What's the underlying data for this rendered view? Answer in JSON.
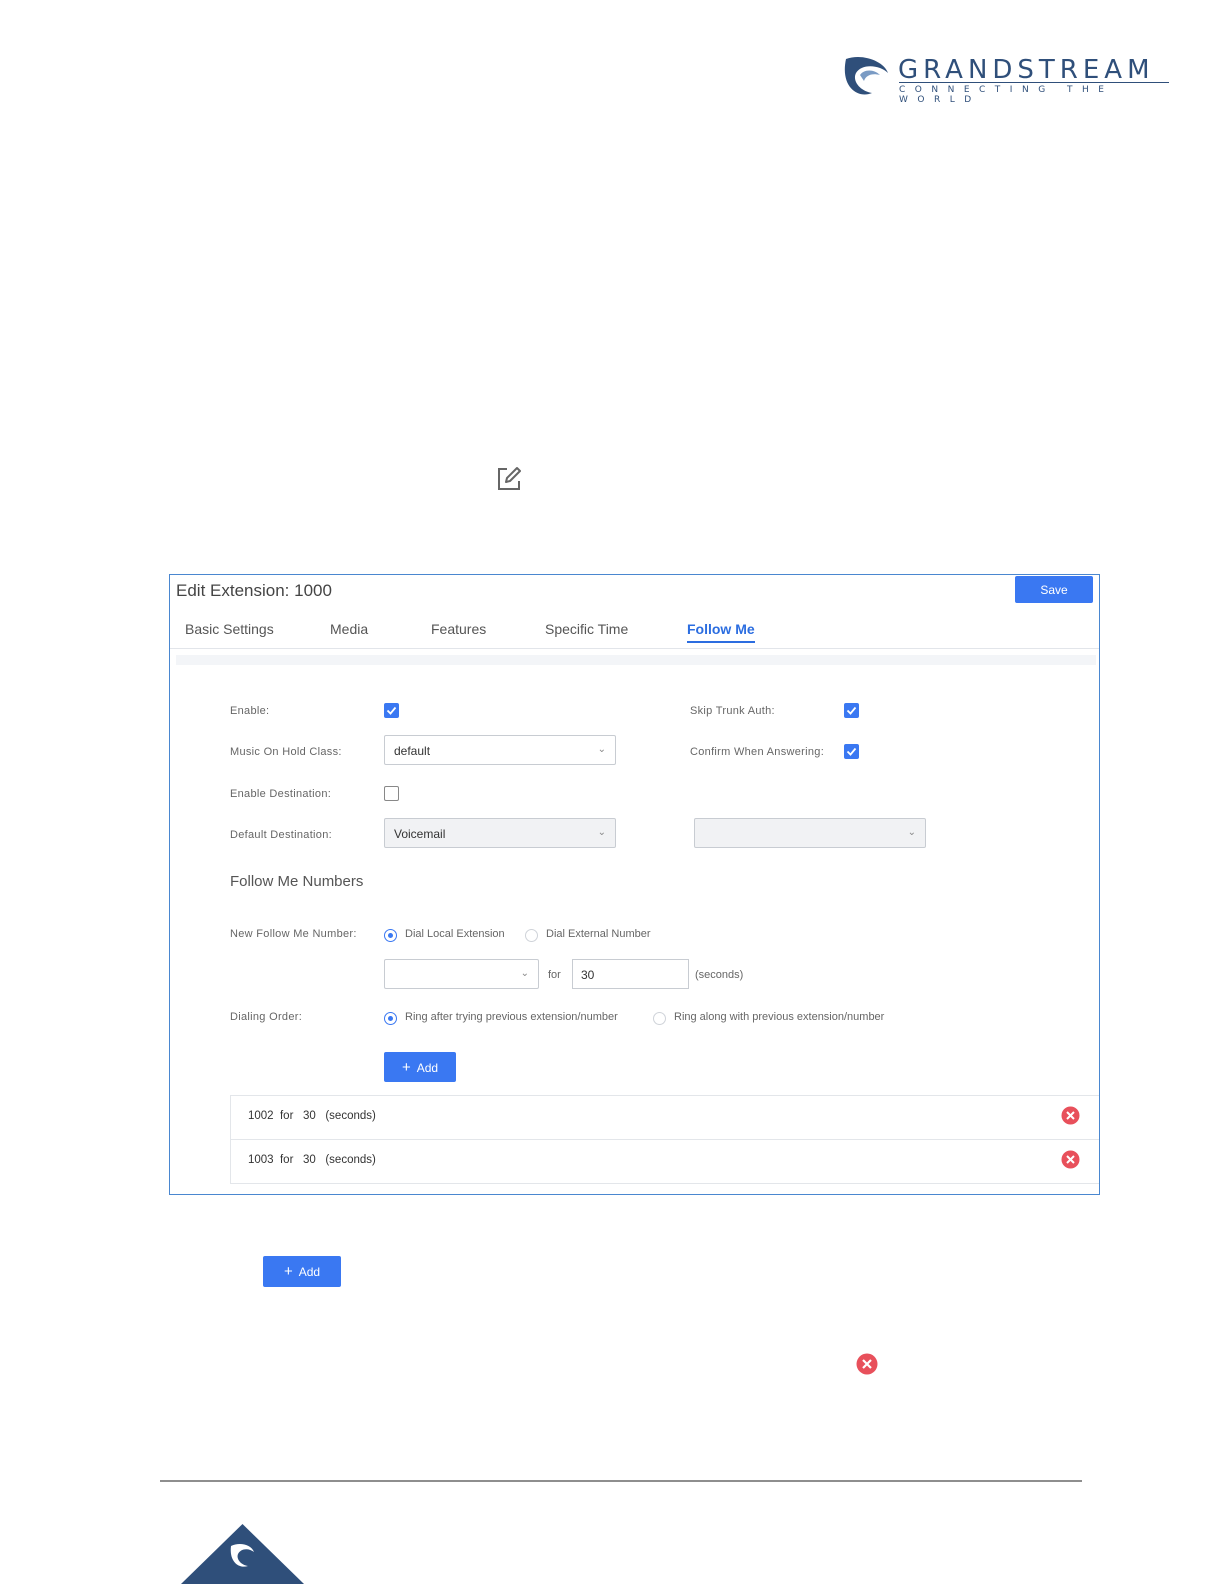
{
  "header": {
    "brand": "GRANDSTREAM",
    "tagline": "CONNECTING THE WORLD"
  },
  "dialog": {
    "title": "Edit Extension: 1000",
    "save_label": "Save",
    "tabs": [
      {
        "label": "Basic Settings"
      },
      {
        "label": "Media"
      },
      {
        "label": "Features"
      },
      {
        "label": "Specific Time"
      },
      {
        "label": "Follow Me",
        "active": true
      }
    ],
    "form": {
      "enable_label": "Enable:",
      "enable_checked": true,
      "skip_trunk_auth_label": "Skip Trunk Auth:",
      "skip_trunk_auth_checked": true,
      "music_on_hold_label": "Music On Hold Class:",
      "music_on_hold_value": "default",
      "confirm_answering_label": "Confirm When Answering:",
      "confirm_answering_checked": true,
      "enable_destination_label": "Enable Destination:",
      "enable_destination_checked": false,
      "default_destination_label": "Default Destination:",
      "default_destination_value": "Voicemail",
      "default_destination_sub_value": "",
      "section_title": "Follow Me Numbers",
      "new_number_label": "New Follow Me Number:",
      "radio_local": "Dial Local Extension",
      "radio_external": "Dial External Number",
      "number_select_value": "",
      "for_label": "for",
      "seconds_value": "30",
      "seconds_label": "(seconds)",
      "dialing_order_label": "Dialing Order:",
      "radio_ring_after": "Ring after trying previous extension/number",
      "radio_ring_along": "Ring along with previous extension/number",
      "add_label": "Add"
    },
    "list": [
      {
        "text": "1002  for   30   (seconds)"
      },
      {
        "text": "1003  for   30   (seconds)"
      }
    ]
  },
  "standalone": {
    "add_label": "Add"
  },
  "colors": {
    "accent": "#3a78f2",
    "brand": "#2f4f7a",
    "delete": "#e8505b"
  }
}
